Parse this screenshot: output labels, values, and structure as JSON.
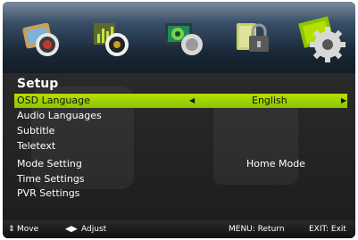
{
  "header": {
    "icons": [
      {
        "name": "picture-icon",
        "active": false
      },
      {
        "name": "sound-icon",
        "active": false
      },
      {
        "name": "channel-icon",
        "active": false
      },
      {
        "name": "lock-icon",
        "active": false
      },
      {
        "name": "setup-gear-icon",
        "active": true
      }
    ]
  },
  "menu": {
    "title": "Setup",
    "items": [
      {
        "label": "OSD Language",
        "value": "English",
        "selected": true
      },
      {
        "label": "Audio Languages",
        "value": ""
      },
      {
        "label": "Subtitle",
        "value": ""
      },
      {
        "label": "Teletext",
        "value": ""
      },
      {
        "label": "Mode Setting",
        "value": "Home Mode"
      },
      {
        "label": "Time Settings",
        "value": ""
      },
      {
        "label": "PVR Settings",
        "value": ""
      }
    ]
  },
  "footer": {
    "move": "Move",
    "adjust": "Adjust",
    "menu_return": "MENU: Return",
    "exit": "EXIT: Exit"
  },
  "colors": {
    "highlight": "#9ccf00",
    "background": "#1e1e1e",
    "header": "#2b3f55"
  }
}
